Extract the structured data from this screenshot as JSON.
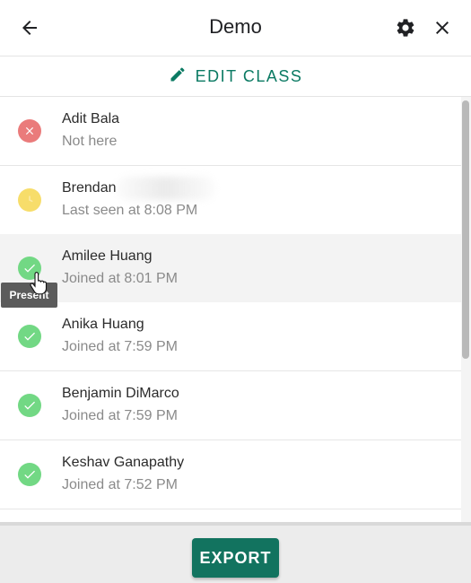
{
  "header": {
    "title": "Demo",
    "back_icon": "arrow-left-icon",
    "settings_icon": "gear-icon",
    "close_icon": "close-icon"
  },
  "edit_class": {
    "label": "EDIT CLASS",
    "icon": "pencil-icon",
    "color": "#0b7a63"
  },
  "students": [
    {
      "name": "Adit Bala",
      "status_text": "Not here",
      "status": "absent",
      "color": "#ea7b7b"
    },
    {
      "name": "Brendan",
      "status_text": "Last seen at 8:08 PM",
      "status": "left",
      "color": "#f7dd6a"
    },
    {
      "name": "Amilee Huang",
      "status_text": "Joined at 8:01 PM",
      "status": "present",
      "color": "#72d884"
    },
    {
      "name": "Anika Huang",
      "status_text": "Joined at 7:59 PM",
      "status": "present",
      "color": "#72d884"
    },
    {
      "name": "Benjamin DiMarco",
      "status_text": "Joined at 7:59 PM",
      "status": "present",
      "color": "#72d884"
    },
    {
      "name": "Keshav Ganapathy",
      "status_text": "Joined at 7:52 PM",
      "status": "present",
      "color": "#72d884"
    }
  ],
  "tooltip": {
    "text": "Present"
  },
  "footer": {
    "export_label": "EXPORT",
    "export_color": "#12735f"
  }
}
